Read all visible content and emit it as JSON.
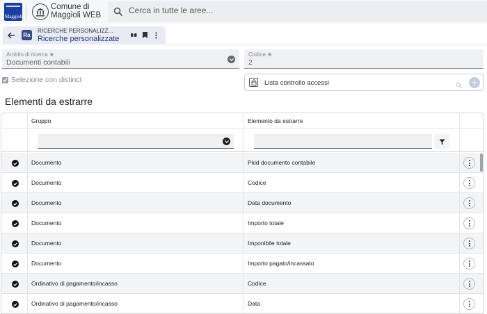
{
  "brand": {
    "logo_text": "Maggioli"
  },
  "app": {
    "name_line1": "Comune di",
    "name_line2": "Maggioli WEB"
  },
  "search": {
    "placeholder": "Cerca in tutte le aree..."
  },
  "tab": {
    "badge": "Ra",
    "subtitle": "RICERCHE PERSONALIZZ...",
    "title": "Ricerche personalizzate"
  },
  "form": {
    "ambito": {
      "label": "Ambito di ricerca",
      "value": "Documenti contabili"
    },
    "codice": {
      "label": "Codice",
      "value": "2"
    },
    "distinct_label": "Selezione con distinct",
    "acl_label": "Lista controllo accessi"
  },
  "section": {
    "title": "Elementi da estrarre"
  },
  "grid": {
    "headers": {
      "gruppo": "Gruppo",
      "elemento": "Elemento da estrarre"
    },
    "rows": [
      {
        "gruppo": "Documento",
        "elemento": "Pkid documento contabile"
      },
      {
        "gruppo": "Documento",
        "elemento": "Codice"
      },
      {
        "gruppo": "Documento",
        "elemento": "Data documento"
      },
      {
        "gruppo": "Documento",
        "elemento": "Importo totale"
      },
      {
        "gruppo": "Documento",
        "elemento": "Imponibile totale"
      },
      {
        "gruppo": "Documento",
        "elemento": "Importo pagato/incassato"
      },
      {
        "gruppo": "Ordinativo di pagamento/incasso",
        "elemento": "Codice"
      },
      {
        "gruppo": "Ordinativo di pagamento/incasso",
        "elemento": "Data"
      }
    ]
  },
  "colors": {
    "accent": "#2a3a7a",
    "brand": "#1a3fa0"
  }
}
